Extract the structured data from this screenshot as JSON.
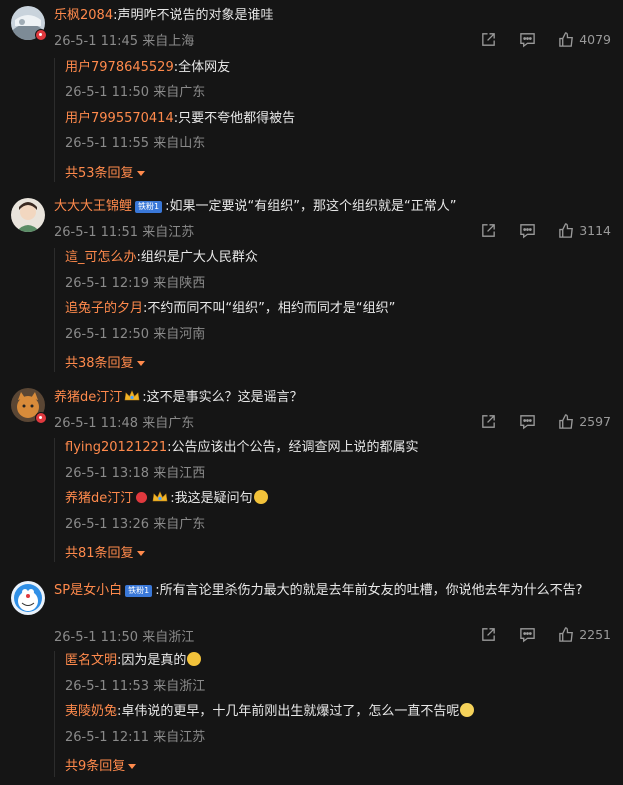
{
  "comments": [
    {
      "user": "乐枫2084",
      "text": ":声明咋不说告的对象是谁哇",
      "meta": "26-5-1 11:45 来自上海",
      "likes": "4079",
      "replies": [
        {
          "user": "用户7978645529",
          "text": ":全体网友",
          "meta": "26-5-1 11:50 来自广东"
        },
        {
          "user": "用户7995570414",
          "text": ":只要不夸他都得被告",
          "meta": "26-5-1 11:55 来自山东"
        }
      ],
      "more": "共53条回复"
    },
    {
      "user": "大大大王锦鲤",
      "badge": "铁粉1",
      "text": ":如果一定要说“有组织”，那这个组织就是“正常人”",
      "meta": "26-5-1 11:51 来自江苏",
      "likes": "3114",
      "replies": [
        {
          "user": "這_可怎么办",
          "text": ":组织是广大人民群众",
          "meta": "26-5-1 12:19 来自陕西"
        },
        {
          "user": "追兔子的夕月",
          "text": ":不约而同不叫“组织”，相约而同才是“组织”",
          "meta": "26-5-1 12:50 来自河南"
        }
      ],
      "more": "共38条回复"
    },
    {
      "user": "养猪de汀汀",
      "text": ":这不是事实么？这是谣言？",
      "meta": "26-5-1 11:48 来自广东",
      "likes": "2597",
      "replies": [
        {
          "user": "flying20121221",
          "text": ":公告应该出个公告，经调查网上说的都属实",
          "meta": "26-5-1 13:18 来自江西"
        },
        {
          "user": "养猪de汀汀",
          "text": ":我这是疑问句",
          "meta": "26-5-1 13:26 来自广东"
        }
      ],
      "more": "共81条回复"
    },
    {
      "user": "SP是女小白",
      "badge": "铁粉1",
      "text": ":所有言论里杀伤力最大的就是去年前女友的吐槽，你说他去年为什么不告?",
      "meta": "26-5-1 11:50 来自浙江",
      "likes": "2251",
      "replies": [
        {
          "user": "匿名文明",
          "text": ":因为是真的",
          "meta": "26-5-1 11:53 来自浙江"
        },
        {
          "user": "夷陵奶兔",
          "text": ":卓伟说的更早，十几年前刚出生就爆过了，怎么一直不告呢",
          "meta": "26-5-1 12:11 来自江苏"
        }
      ],
      "more": "共9条回复"
    }
  ],
  "icons": {
    "share": "share-icon",
    "comment": "comment-icon",
    "like": "thumbs-up-icon"
  },
  "colors": {
    "background": "#151515",
    "username": "#ff8a4c",
    "meta": "#8a8a8a",
    "badge": "#3a78d8"
  }
}
